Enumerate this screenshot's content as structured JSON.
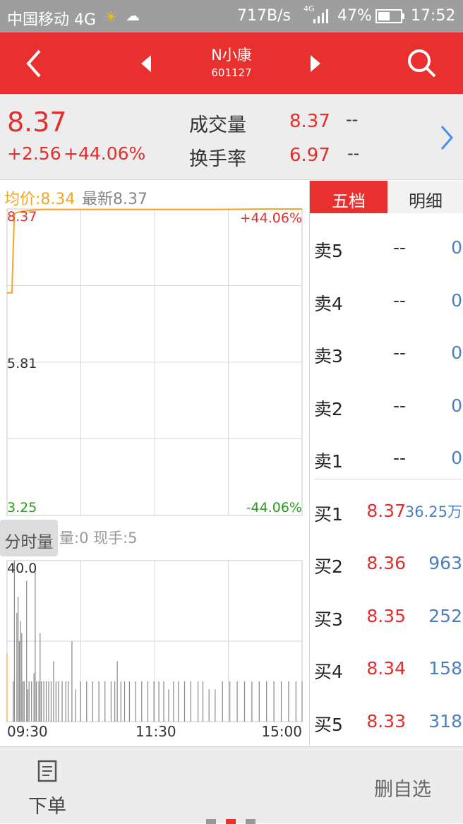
{
  "status_bar": {
    "carrier": "中国移动 4G",
    "speed": "717B/s",
    "net": "4G",
    "battery": "47%",
    "time": "17:52"
  },
  "header": {
    "title": "N小康",
    "code": "601127",
    "back_icon": "chevron-left-icon",
    "prev_icon": "triangle-left-icon",
    "next_icon": "triangle-right-icon",
    "search_icon": "search-icon"
  },
  "quote": {
    "price": "8.37",
    "change": "+2.56",
    "change_pct": "+44.06%",
    "volume_label": "成交量",
    "volume_value": "8.37",
    "volume_extra": "--",
    "turnover_label": "换手率",
    "turnover_value": "6.97",
    "turnover_extra": "--"
  },
  "chart": {
    "avg_label": "均价",
    "avg_value": ":8.34",
    "latest_label": "最新",
    "latest_value": "8.37",
    "y_top": "8.37",
    "y_mid": "5.81",
    "y_bottom": "3.25",
    "pct_top": "+44.06%",
    "pct_bottom": "-44.06%",
    "volume_tab": "分时量",
    "volume_info": "量:0 现手:5",
    "vol_max": "40.0",
    "times": [
      "09:30",
      "11:30",
      "15:00"
    ],
    "colors": {
      "price_line": "#f5a623",
      "grid": "#d8d8d8",
      "bar": "#888888",
      "green": "#2a9d1e"
    }
  },
  "chart_data": {
    "type": "line",
    "title": "",
    "xlabel": "",
    "ylabel": "",
    "x_ticks": [
      "09:30",
      "11:30",
      "15:00"
    ],
    "ylim": [
      3.25,
      8.37
    ],
    "price_series": {
      "name": "均价",
      "x": [
        0,
        4,
        5,
        6,
        8,
        12,
        16,
        20,
        30,
        60,
        100,
        140,
        170,
        210,
        241
      ],
      "values": [
        6.97,
        6.97,
        7.7,
        8.29,
        8.31,
        8.33,
        8.34,
        8.35,
        8.36,
        8.36,
        8.36,
        8.36,
        8.36,
        8.37,
        8.37
      ]
    },
    "volume_series": {
      "name": "分时量",
      "ylim": [
        0,
        40
      ],
      "x": [
        0,
        5,
        6,
        8,
        9,
        10,
        11,
        12,
        13,
        14,
        16,
        17,
        18,
        20,
        22,
        23,
        24,
        26,
        27,
        28,
        30,
        32,
        34,
        36,
        38,
        40,
        42,
        45,
        48,
        50,
        53,
        56,
        60,
        65,
        70,
        75,
        80,
        85,
        88,
        90,
        93,
        96,
        100,
        105,
        110,
        115,
        120,
        124,
        128,
        132,
        136,
        140,
        145,
        150,
        156,
        160,
        165,
        170,
        176,
        182,
        188,
        194,
        200,
        206,
        212,
        218,
        224,
        230,
        236,
        241
      ],
      "values": [
        17,
        10,
        40,
        27,
        31,
        20,
        25,
        22,
        10,
        10,
        35,
        8,
        10,
        10,
        12,
        38,
        10,
        10,
        22,
        10,
        10,
        10,
        10,
        10,
        15,
        10,
        10,
        10,
        10,
        10,
        20,
        8,
        10,
        10,
        10,
        10,
        10,
        10,
        10,
        15,
        10,
        10,
        10,
        10,
        10,
        10,
        10,
        10,
        10,
        8,
        10,
        10,
        10,
        10,
        10,
        10,
        8,
        8,
        10,
        10,
        10,
        10,
        10,
        10,
        10,
        10,
        10,
        10,
        10,
        10
      ]
    }
  },
  "orderbook": {
    "tab_active": "五档",
    "tab_inactive": "明细",
    "asks": [
      {
        "label": "卖5",
        "price": "--",
        "vol": "0"
      },
      {
        "label": "卖4",
        "price": "--",
        "vol": "0"
      },
      {
        "label": "卖3",
        "price": "--",
        "vol": "0"
      },
      {
        "label": "卖2",
        "price": "--",
        "vol": "0"
      },
      {
        "label": "卖1",
        "price": "--",
        "vol": "0"
      }
    ],
    "bids": [
      {
        "label": "买1",
        "price": "8.37",
        "vol": "36.25万"
      },
      {
        "label": "买2",
        "price": "8.36",
        "vol": "963"
      },
      {
        "label": "买3",
        "price": "8.35",
        "vol": "252"
      },
      {
        "label": "买4",
        "price": "8.34",
        "vol": "158"
      },
      {
        "label": "买5",
        "price": "8.33",
        "vol": "318"
      }
    ]
  },
  "bottom": {
    "order_label": "下单",
    "order_icon": "document-icon",
    "remove_label": "删自选"
  }
}
